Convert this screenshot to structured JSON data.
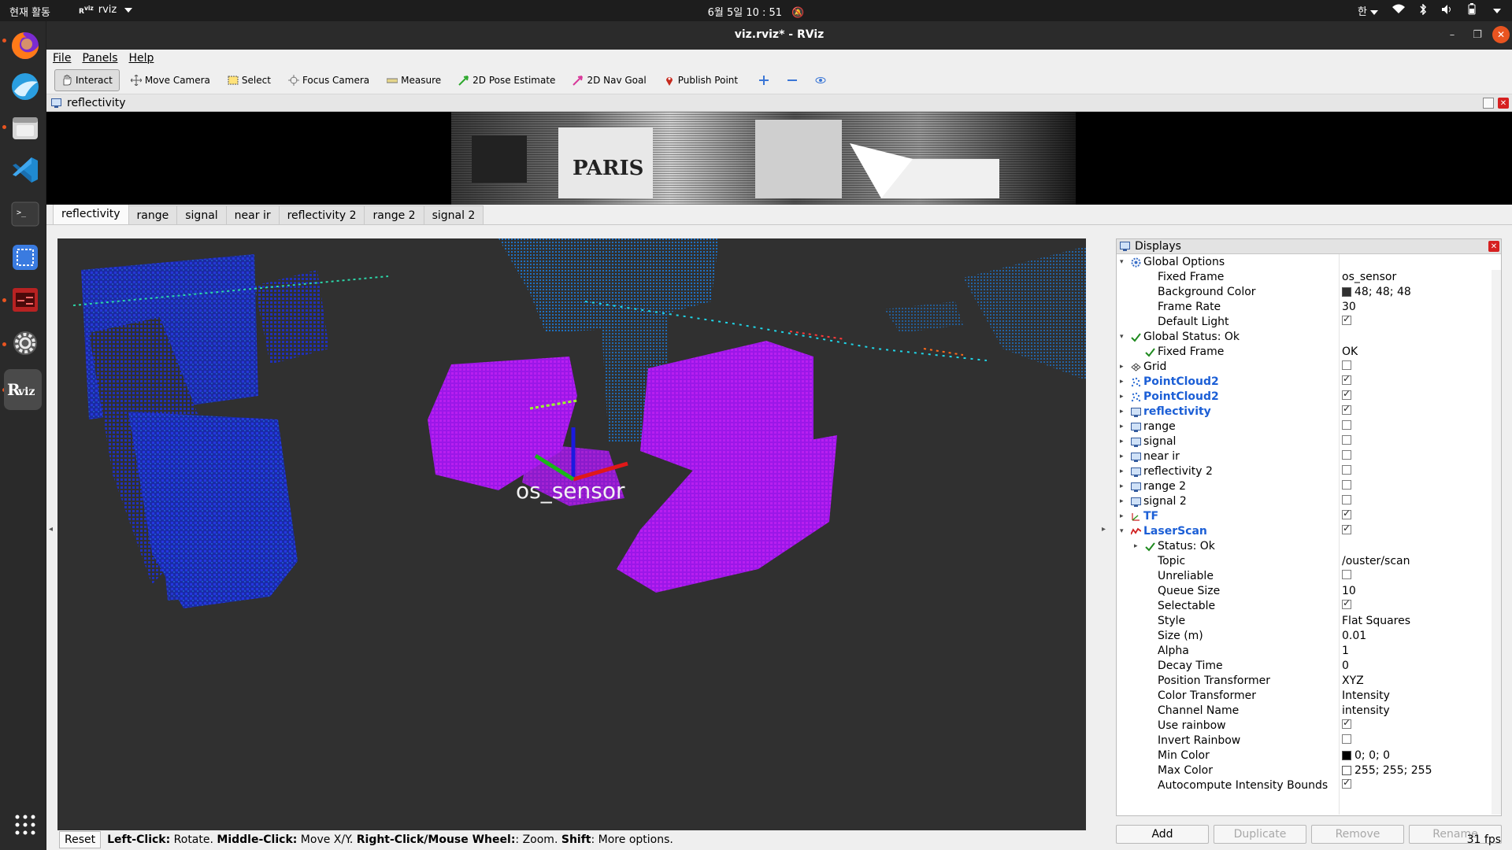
{
  "topbar": {
    "activities": "현재 활동",
    "app_name": "rviz",
    "clock": "6월 5일  10 : 51",
    "input_method": "한"
  },
  "window": {
    "title": "viz.rviz* - RViz"
  },
  "menu": {
    "file": "File",
    "panels": "Panels",
    "help": "Help"
  },
  "toolbar": {
    "interact": "Interact",
    "move_camera": "Move Camera",
    "select": "Select",
    "focus_camera": "Focus Camera",
    "measure": "Measure",
    "pose_estimate": "2D Pose Estimate",
    "nav_goal": "2D Nav Goal",
    "publish_point": "Publish Point"
  },
  "image_panel": {
    "title": "reflectivity"
  },
  "tabs": [
    "reflectivity",
    "range",
    "signal",
    "near ir",
    "reflectivity 2",
    "range 2",
    "signal 2"
  ],
  "viewport": {
    "frame_label": "os_sensor"
  },
  "displays": {
    "title": "Displays",
    "rows": [
      {
        "label": "Global Options",
        "value": ""
      },
      {
        "label": "Fixed Frame",
        "value": "os_sensor"
      },
      {
        "label": "Background Color",
        "value": "48; 48; 48"
      },
      {
        "label": "Frame Rate",
        "value": "30"
      },
      {
        "label": "Default Light",
        "value": ""
      },
      {
        "label": "Global Status: Ok",
        "value": ""
      },
      {
        "label": "Fixed Frame",
        "value": "OK"
      },
      {
        "label": "Grid",
        "value": ""
      },
      {
        "label": "PointCloud2",
        "value": ""
      },
      {
        "label": "PointCloud2",
        "value": ""
      },
      {
        "label": "reflectivity",
        "value": ""
      },
      {
        "label": "range",
        "value": ""
      },
      {
        "label": "signal",
        "value": ""
      },
      {
        "label": "near ir",
        "value": ""
      },
      {
        "label": "reflectivity 2",
        "value": ""
      },
      {
        "label": "range 2",
        "value": ""
      },
      {
        "label": "signal 2",
        "value": ""
      },
      {
        "label": "TF",
        "value": ""
      },
      {
        "label": "LaserScan",
        "value": ""
      },
      {
        "label": "Status: Ok",
        "value": ""
      },
      {
        "label": "Topic",
        "value": "/ouster/scan"
      },
      {
        "label": "Unreliable",
        "value": ""
      },
      {
        "label": "Queue Size",
        "value": "10"
      },
      {
        "label": "Selectable",
        "value": ""
      },
      {
        "label": "Style",
        "value": "Flat Squares"
      },
      {
        "label": "Size (m)",
        "value": "0.01"
      },
      {
        "label": "Alpha",
        "value": "1"
      },
      {
        "label": "Decay Time",
        "value": "0"
      },
      {
        "label": "Position Transformer",
        "value": "XYZ"
      },
      {
        "label": "Color Transformer",
        "value": "Intensity"
      },
      {
        "label": "Channel Name",
        "value": "intensity"
      },
      {
        "label": "Use rainbow",
        "value": ""
      },
      {
        "label": "Invert Rainbow",
        "value": ""
      },
      {
        "label": "Min Color",
        "value": "0; 0; 0"
      },
      {
        "label": "Max Color",
        "value": "255; 255; 255"
      },
      {
        "label": "Autocompute Intensity Bounds",
        "value": ""
      }
    ],
    "buttons": {
      "add": "Add",
      "duplicate": "Duplicate",
      "remove": "Remove",
      "rename": "Rename"
    }
  },
  "status": {
    "reset": "Reset",
    "hint_left_b": "Left-Click:",
    "hint_left": " Rotate. ",
    "hint_mid_b": "Middle-Click:",
    "hint_mid": " Move X/Y. ",
    "hint_right_b": "Right-Click/Mouse Wheel:",
    "hint_right": ": Zoom. ",
    "hint_shift_b": "Shift",
    "hint_shift": ": More options.",
    "fps": "31 fps"
  },
  "colors": {
    "accent": "#e95420",
    "viewport_bg": "#303030",
    "display_link": "#1c5fd6"
  }
}
